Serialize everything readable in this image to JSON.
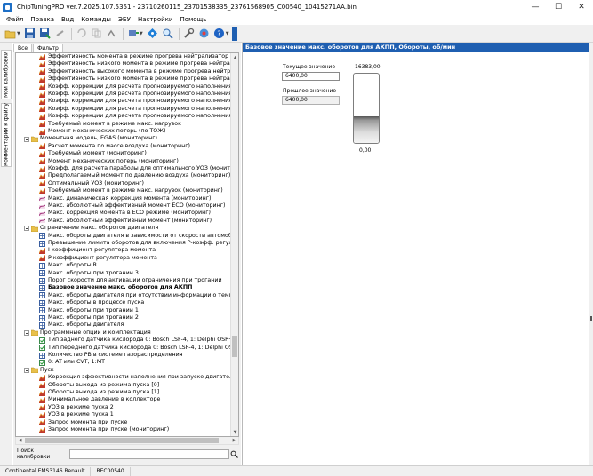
{
  "window": {
    "title": "ChipTuningPRO ver.7.2025.107.5351 - 23710260115_23701538335_23761568905_C00540_10415271AA.bin",
    "minimize": "—",
    "maximize": "☐",
    "close": "✕"
  },
  "menu": [
    "Файл",
    "Правка",
    "Вид",
    "Команды",
    "ЭБУ",
    "Настройки",
    "Помощь"
  ],
  "vertical_tabs": [
    "Мои калибровки",
    "Комментарии к файлу"
  ],
  "tree_tabs": [
    "Все",
    "Фильтр"
  ],
  "tree": [
    {
      "kind": "item",
      "icon": "surface",
      "label": "Эффективность момента в режиме прогрева нейтрализатор холод"
    },
    {
      "kind": "item",
      "icon": "surface",
      "label": "Эффективность низкого момента в режиме прогрева нейтрализато"
    },
    {
      "kind": "item",
      "icon": "surface",
      "label": "Эффективность высокого момента в режиме прогрева нейтрализато"
    },
    {
      "kind": "item",
      "icon": "surface",
      "label": "Эффективность низкого момента в режиме прогрева нейтрализато"
    },
    {
      "kind": "item",
      "icon": "surface",
      "label": "Коэфф. коррекции для расчета прогнозируемого наполнения (мон"
    },
    {
      "kind": "item",
      "icon": "surface",
      "label": "Коэфф. коррекции для расчета прогнозируемого наполнения для i"
    },
    {
      "kind": "item",
      "icon": "surface",
      "label": "Коэфф. коррекции для расчета прогнозируемого наполнения для i"
    },
    {
      "kind": "item",
      "icon": "surface",
      "label": "Коэфф. коррекции для расчета прогнозируемого наполнения для i"
    },
    {
      "kind": "item",
      "icon": "surface",
      "label": "Коэфф. коррекции для расчета прогнозируемого наполнения для i"
    },
    {
      "kind": "item",
      "icon": "surface",
      "label": "Требуемый момент в режиме макс. нагрузок"
    },
    {
      "kind": "item",
      "icon": "surface",
      "label": "Момент механических потерь (по ТОЖ)"
    },
    {
      "kind": "folder",
      "label": "Моментная модель, EGAS (мониторинг)"
    },
    {
      "kind": "item",
      "icon": "surface",
      "label": "Расчет момента по массе воздуха (мониторинг)"
    },
    {
      "kind": "item",
      "icon": "surface",
      "label": "Требуемый момент (мониторинг)"
    },
    {
      "kind": "item",
      "icon": "surface",
      "label": "Момент механических потерь (мониторинг)"
    },
    {
      "kind": "item",
      "icon": "surface",
      "label": "Коэфф. для расчета параболы для оптимального УОЗ (мониторинг"
    },
    {
      "kind": "item",
      "icon": "surface",
      "label": "Предполагаемый момент по давлению воздуха (мониторинг)"
    },
    {
      "kind": "item",
      "icon": "surface",
      "label": "Оптимальный УОЗ (мониторинг)"
    },
    {
      "kind": "item",
      "icon": "surface",
      "label": "Требуемый момент в режиме макс. нагрузок (мониторинг)"
    },
    {
      "kind": "item",
      "icon": "curve",
      "label": "Макс. динамическая коррекция момента (мониторинг)"
    },
    {
      "kind": "item",
      "icon": "curve",
      "label": "Макс. абсолютный эффективный момент ECO (мониторинг)"
    },
    {
      "kind": "item",
      "icon": "curve",
      "label": "Макс. коррекция момента в ECO режиме (мониторинг)"
    },
    {
      "kind": "item",
      "icon": "curve",
      "label": "Макс. абсолютный эффективный момент (мониторинг)"
    },
    {
      "kind": "folder",
      "label": "Ограничение макс. оборотов двигателя"
    },
    {
      "kind": "item",
      "icon": "grid",
      "label": "Макс. обороты двигателя в зависимости от скорости автомобиля"
    },
    {
      "kind": "item",
      "icon": "grid",
      "label": "Превышение лимита оборотов для включения P-коэфф. регулятора"
    },
    {
      "kind": "item",
      "icon": "surface",
      "label": "I-коэффициент регулятора момента"
    },
    {
      "kind": "item",
      "icon": "surface",
      "label": "P-коэффициент регулятора момента"
    },
    {
      "kind": "item",
      "icon": "grid",
      "label": "Макс. обороты R"
    },
    {
      "kind": "item",
      "icon": "grid",
      "label": "Макс. обороты при трогании 3"
    },
    {
      "kind": "item",
      "icon": "grid",
      "label": "Порог скорости для активации ограничения при трогании"
    },
    {
      "kind": "item",
      "icon": "grid",
      "label": "Базовое значение макс. оборотов для АКПП",
      "selected": true
    },
    {
      "kind": "item",
      "icon": "grid",
      "label": "Макс. обороты двигателя при отсутствии информации о температу"
    },
    {
      "kind": "item",
      "icon": "grid",
      "label": "Макс. обороты в процессе пуска"
    },
    {
      "kind": "item",
      "icon": "grid",
      "label": "Макс. обороты при трогании 1"
    },
    {
      "kind": "item",
      "icon": "grid",
      "label": "Макс. обороты при трогании 2"
    },
    {
      "kind": "item",
      "icon": "grid",
      "label": "Макс. обороты двигателя"
    },
    {
      "kind": "folder",
      "label": "Программные опции и комплектация"
    },
    {
      "kind": "item",
      "icon": "check",
      "label": "Тип заднего датчика кислорода 0: Bosch LSF-4, 1: Delphi OSP+"
    },
    {
      "kind": "item",
      "icon": "check",
      "label": "Тип переднего датчика кислорода 0: Bosch LSF-4, 1: Delphi OSP+"
    },
    {
      "kind": "item",
      "icon": "grid",
      "label": "Количество РВ в системе газораспределения"
    },
    {
      "kind": "item",
      "icon": "check",
      "label": "0: AT или CVT, 1:MT"
    },
    {
      "kind": "folder",
      "label": "Пуск"
    },
    {
      "kind": "item",
      "icon": "surface",
      "label": "Коррекция эффективности наполнения при запуске двигателя"
    },
    {
      "kind": "item",
      "icon": "surface",
      "label": "Обороты выхода из режима пуска [0]"
    },
    {
      "kind": "item",
      "icon": "surface",
      "label": "Обороты выхода из режима пуска [1]"
    },
    {
      "kind": "item",
      "icon": "surface",
      "label": "Минимальное давление в коллекторе"
    },
    {
      "kind": "item",
      "icon": "surface",
      "label": "УОЗ в режиме пуска 2"
    },
    {
      "kind": "item",
      "icon": "surface",
      "label": "УОЗ в режиме пуска 1"
    },
    {
      "kind": "item",
      "icon": "surface",
      "label": "Запрос момента при пуске"
    },
    {
      "kind": "item",
      "icon": "surface",
      "label": "Запрос момента при пуске (мониторинг)"
    }
  ],
  "search": {
    "label": "Поиск калибровки",
    "value": ""
  },
  "main": {
    "header": "Базовое значение макс. оборотов для АКПП, Обороты, об/мин",
    "current_label": "Текущее значение",
    "current_value": "6400,00",
    "previous_label": "Прошлое значение",
    "previous_value": "6400,00",
    "gauge_max": "16383,00",
    "gauge_min": "0,00",
    "gauge_level": 0.39
  },
  "status": [
    "Continental EMS3146 Renault",
    "REC00540"
  ],
  "colors": {
    "accent": "#1f5fb1",
    "folder": "#e8c04a",
    "surface": "#c0392b"
  }
}
